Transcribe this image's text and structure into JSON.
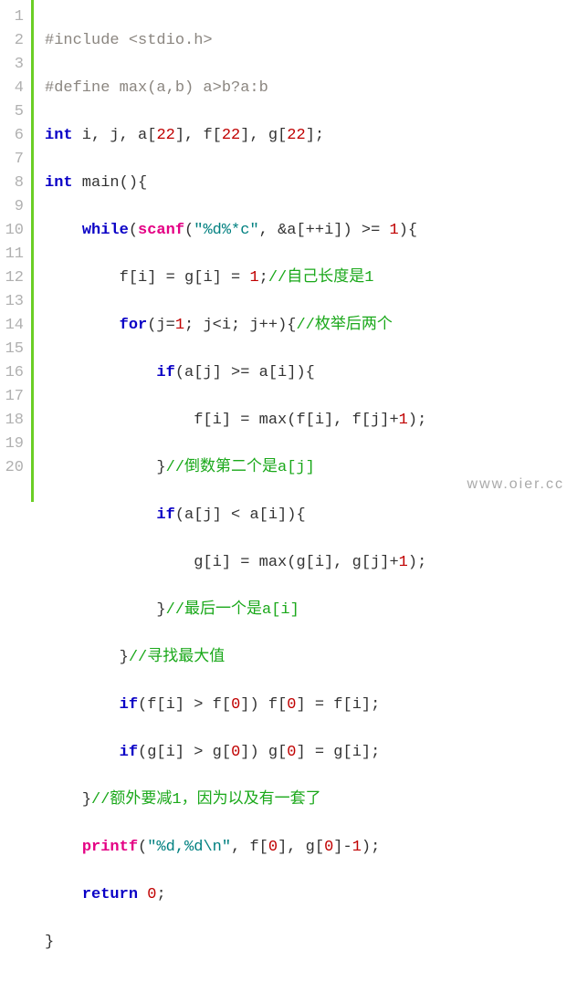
{
  "gutter": {
    "l1": "1",
    "l2": "2",
    "l3": "3",
    "l4": "4",
    "l5": "5",
    "l6": "6",
    "l7": "7",
    "l8": "8",
    "l9": "9",
    "l10": "10",
    "l11": "11",
    "l12": "12",
    "l13": "13",
    "l14": "14",
    "l15": "15",
    "l16": "16",
    "l17": "17",
    "l18": "18",
    "l19": "19",
    "l20": "20"
  },
  "code": {
    "l1": {
      "a": "#include <stdio.h>"
    },
    "l2": {
      "a": "#define max(a,b) a>b?a:b"
    },
    "l3": {
      "a": "int",
      "b": " i, j, a[",
      "n1": "22",
      "c": "], f[",
      "n2": "22",
      "d": "], g[",
      "n3": "22",
      "e": "];"
    },
    "l4": {
      "a": "int",
      "b": " main(){"
    },
    "l5": {
      "ind": "    ",
      "a": "while",
      "p1": "(",
      "fn": "scanf",
      "p2": "(",
      "s": "\"%d%*c\"",
      "c": ", &a[++i]) >= ",
      "n": "1",
      "d": "){"
    },
    "l6": {
      "ind": "        ",
      "a": "f[i] = g[i] = ",
      "n": "1",
      "b": ";",
      "cm": "//自己长度是1"
    },
    "l7": {
      "ind": "        ",
      "a": "for",
      "b": "(j=",
      "n": "1",
      "c": "; j<i; j++){",
      "cm": "//枚举后两个"
    },
    "l8": {
      "ind": "            ",
      "a": "if",
      "b": "(a[j] >= a[i]){"
    },
    "l9": {
      "ind": "                ",
      "a": "f[i] = max(f[i], f[j]+",
      "n": "1",
      "b": ");"
    },
    "l10": {
      "ind": "            ",
      "a": "}",
      "cm": "//倒数第二个是a[j]"
    },
    "l11": {
      "ind": "            ",
      "a": "if",
      "b": "(a[j] < a[i]){"
    },
    "l12": {
      "ind": "                ",
      "a": "g[i] = max(g[i], g[j]+",
      "n": "1",
      "b": ");"
    },
    "l13": {
      "ind": "            ",
      "a": "}",
      "cm": "//最后一个是a[i]"
    },
    "l14": {
      "ind": "        ",
      "a": "}",
      "cm": "//寻找最大值"
    },
    "l15": {
      "ind": "        ",
      "a": "if",
      "b": "(f[i] > f[",
      "n1": "0",
      "c": "]) f[",
      "n2": "0",
      "d": "] = f[i];"
    },
    "l16": {
      "ind": "        ",
      "a": "if",
      "b": "(g[i] > g[",
      "n1": "0",
      "c": "]) g[",
      "n2": "0",
      "d": "] = g[i];"
    },
    "l17": {
      "ind": "    ",
      "a": "}",
      "cm": "//额外要减1，因为以及有一套了"
    },
    "l18": {
      "ind": "    ",
      "fn": "printf",
      "p": "(",
      "s": "\"%d,%d\\n\"",
      "a": ", f[",
      "n1": "0",
      "b": "], g[",
      "n2": "0",
      "c": "]-",
      "n3": "1",
      "d": ");"
    },
    "l19": {
      "ind": "    ",
      "a": "return",
      "b": " ",
      "n": "0",
      "c": ";"
    },
    "l20": {
      "a": "}"
    }
  },
  "watermark": "www.oier.cc"
}
